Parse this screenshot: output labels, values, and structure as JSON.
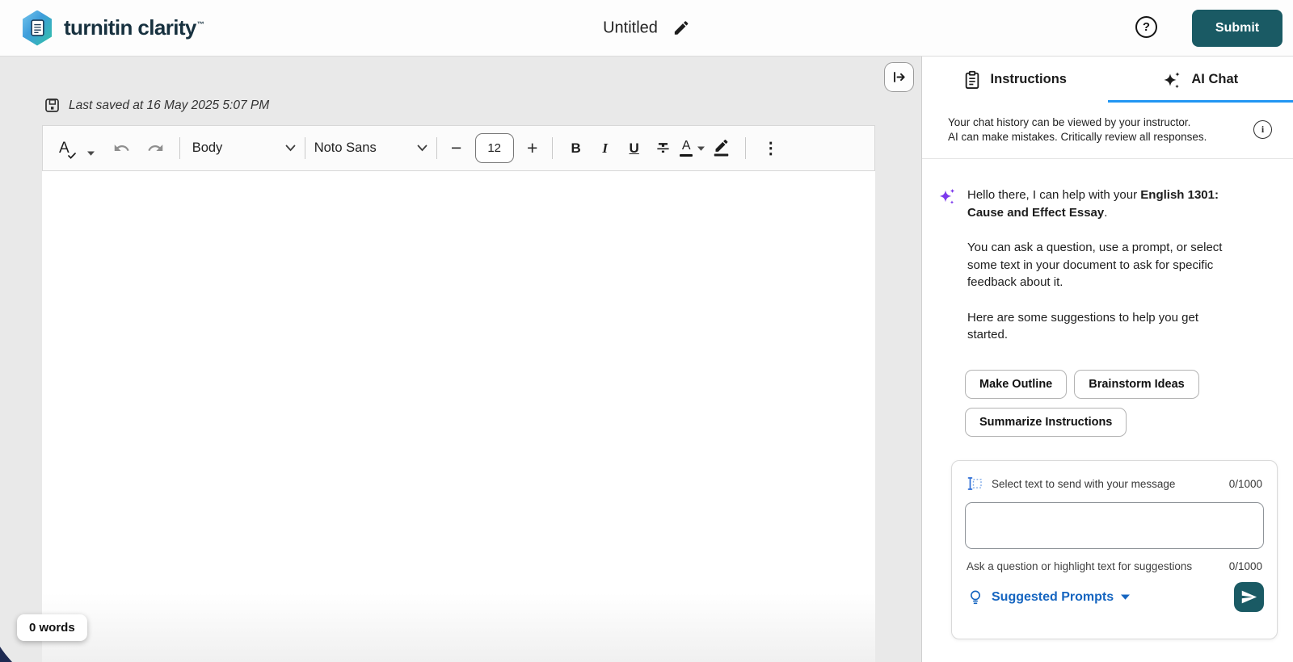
{
  "header": {
    "brand": "turnitin clarity",
    "brand_tm": "™",
    "doc_title": "Untitled",
    "submit_label": "Submit"
  },
  "editor": {
    "last_saved": "Last saved at 16 May 2025 5:07 PM",
    "word_count": "0 words",
    "toolbar": {
      "paragraph_style": "Body",
      "font_family": "Noto Sans",
      "font_size": "12"
    }
  },
  "chat_panel": {
    "tabs": {
      "instructions": "Instructions",
      "ai_chat": "AI Chat"
    },
    "disclaimer_line1": "Your chat history can be viewed by your instructor.",
    "disclaimer_line2": "AI can make mistakes. Critically review all responses.",
    "greeting": {
      "prefix": "Hello there, I can help with your ",
      "assignment": "English 1301: Cause and Effect Essay",
      "suffix": ".",
      "para2": "You can ask a question, use a prompt, or select some text in your document to ask for specific feedback about it.",
      "para3": "Here are some suggestions to help you get started."
    },
    "suggestions": [
      "Make Outline",
      "Brainstorm Ideas",
      "Summarize Instructions"
    ],
    "composer": {
      "select_text_label": "Select text to send with your message",
      "select_text_counter": "0/1000",
      "message_value": "",
      "message_hint": "Ask a question or highlight text for suggestions",
      "message_counter": "0/1000",
      "suggested_prompts_label": "Suggested Prompts"
    }
  },
  "icons": {
    "help_glyph": "?",
    "info_glyph": "i",
    "spellcheck_glyph": "A",
    "bold_glyph": "B",
    "italic_glyph": "I",
    "underline_glyph": "U",
    "color_glyph": "A",
    "minus_glyph": "−",
    "plus_glyph": "+",
    "more_glyph": "⋮"
  },
  "colors": {
    "submit_teal": "#1a5a64",
    "active_tab_blue": "#2196f3",
    "link_blue": "#1565c0",
    "sparkle_purple": "#7c3aed",
    "brand_navy": "#17313f"
  }
}
